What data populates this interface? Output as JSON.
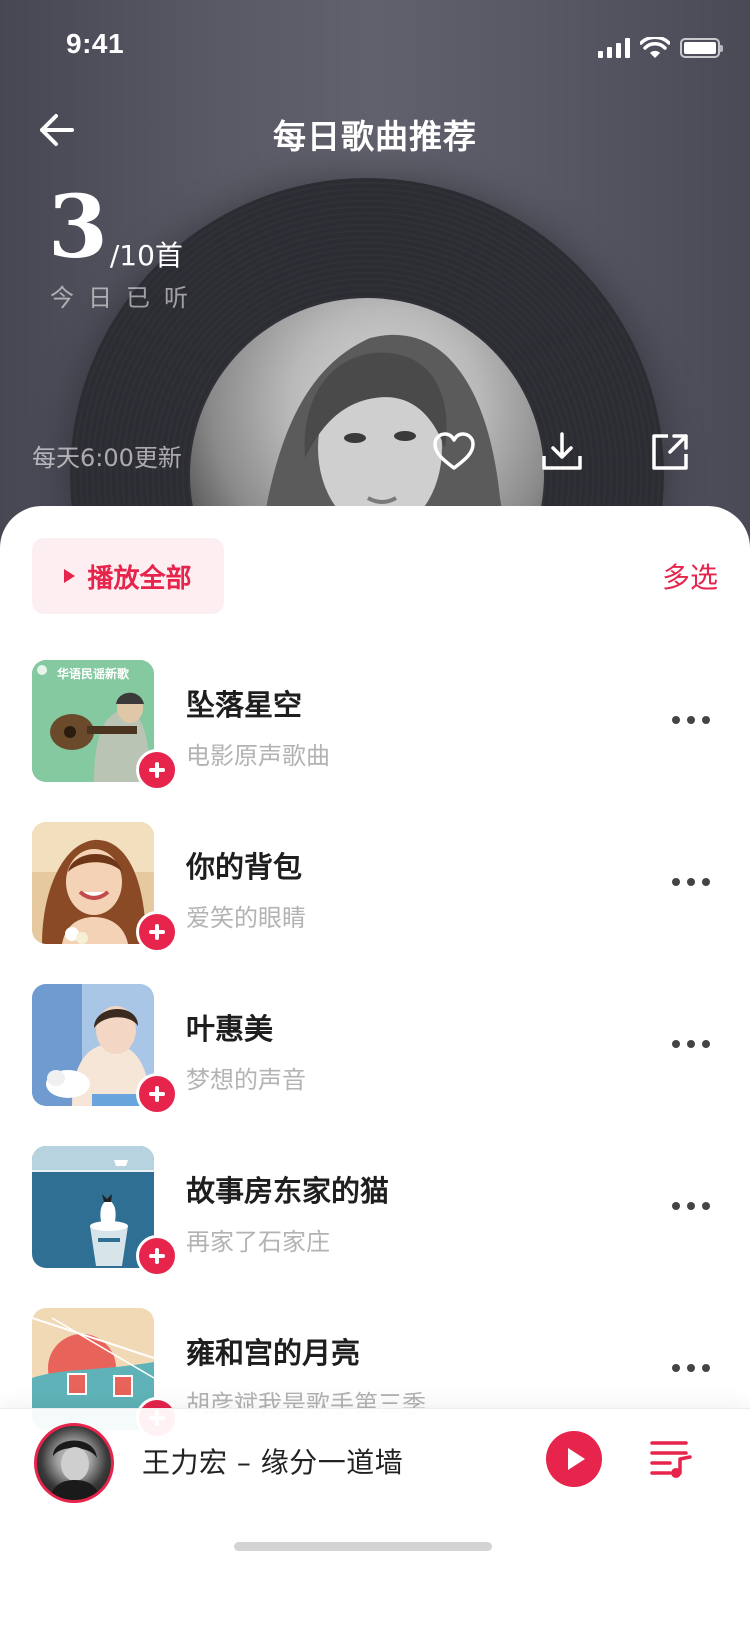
{
  "status_bar": {
    "time": "9:41"
  },
  "header": {
    "title": "每日歌曲推荐",
    "listened_count": "3",
    "listened_total": "/10首",
    "listened_caption": "今日已听",
    "update_note": "每天6:00更新"
  },
  "list_controls": {
    "play_all_label": "播放全部",
    "multi_select_label": "多选"
  },
  "songs": [
    {
      "title": "坠落星空",
      "subtitle": "电影原声歌曲",
      "cover_label": "华语民谣新歌"
    },
    {
      "title": "你的背包",
      "subtitle": "爱笑的眼睛"
    },
    {
      "title": "叶惠美",
      "subtitle": "梦想的声音"
    },
    {
      "title": "故事房东家的猫",
      "subtitle": "再家了石家庄"
    },
    {
      "title": "雍和宫的月亮",
      "subtitle": "胡彦斌我是歌手第三季"
    }
  ],
  "now_playing": {
    "text": "王力宏 – 缘分一道墙"
  },
  "colors": {
    "accent": "#e6244c",
    "header_bg": "#5a5a66",
    "subtitle": "#b3b3b3"
  }
}
